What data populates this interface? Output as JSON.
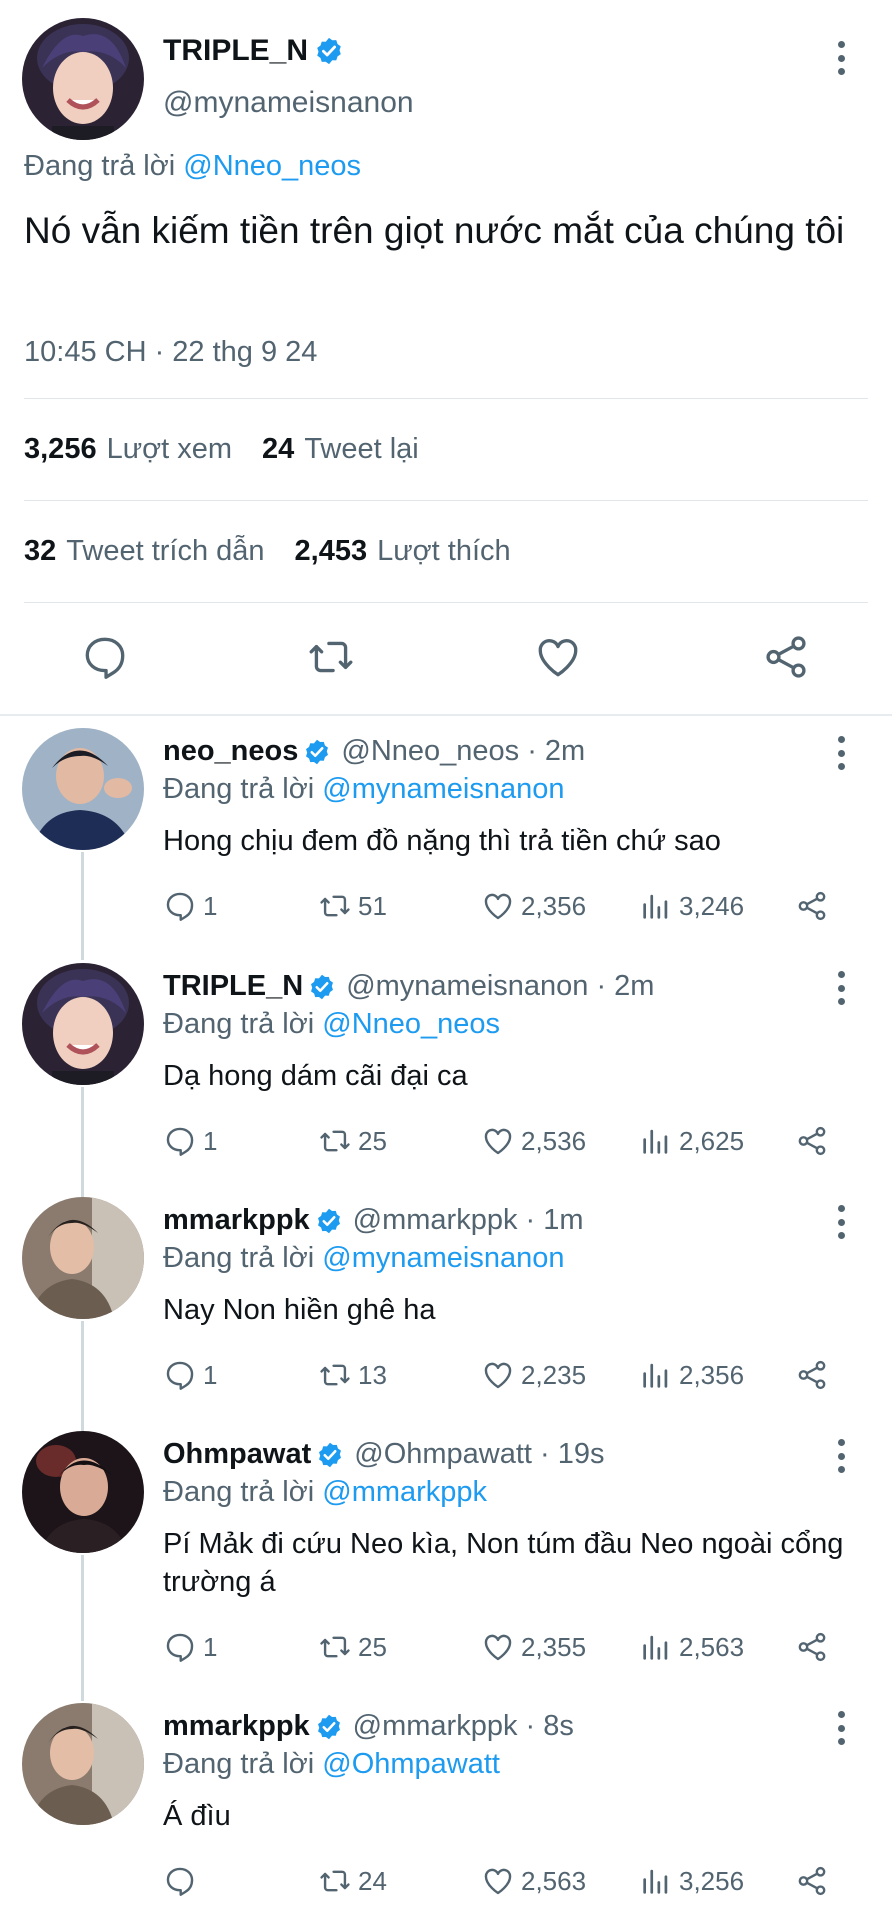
{
  "main_tweet": {
    "display_name": "TRIPLE_N",
    "handle": "@mynameisnanon",
    "replying_prefix": "Đang trả lời ",
    "replying_to": "@Nneo_neos",
    "text": "Nó vẫn kiếm tiền trên giọt nước mắt của chúng tôi",
    "timestamp": "10:45 CH · 22 thg 9 24",
    "views_count": "3,256",
    "views_label": "Lượt xem",
    "retweets_count": "24",
    "retweets_label": "Tweet lại",
    "quotes_count": "32",
    "quotes_label": "Tweet trích dẫn",
    "likes_count": "2,453",
    "likes_label": "Lượt thích"
  },
  "replies": [
    {
      "display_name": "neo_neos",
      "handle_time": "@Nneo_neos · 2m",
      "replying_prefix": "Đang trả lời ",
      "replying_to": "@mynameisnanon",
      "text": "Hong chịu đem đồ nặng thì trả tiền chứ sao",
      "replies": "1",
      "retweets": "51",
      "likes": "2,356",
      "views": "3,246"
    },
    {
      "display_name": "TRIPLE_N",
      "handle_time": "@mynameisnanon · 2m",
      "replying_prefix": "Đang trả lời ",
      "replying_to": "@Nneo_neos",
      "text": "Dạ hong dám cãi đại ca",
      "replies": "1",
      "retweets": "25",
      "likes": "2,536",
      "views": "2,625"
    },
    {
      "display_name": "mmarkppk",
      "handle_time": "@mmarkppk · 1m",
      "replying_prefix": "Đang trả lời ",
      "replying_to": "@mynameisnanon",
      "text": "Nay Non hiền ghê ha",
      "replies": "1",
      "retweets": "13",
      "likes": "2,235",
      "views": "2,356"
    },
    {
      "display_name": "Ohmpawat",
      "handle_time": "@Ohmpawatt · 19s",
      "replying_prefix": "Đang trả lời ",
      "replying_to": "@mmarkppk",
      "text": "Pí Mảk đi cứu Neo kìa, Non túm đầu Neo ngoài cổng trường á",
      "replies": "1",
      "retweets": "25",
      "likes": "2,355",
      "views": "2,563"
    },
    {
      "display_name": "mmarkppk",
      "handle_time": "@mmarkppk · 8s",
      "replying_prefix": "Đang trả lời ",
      "replying_to": "@Ohmpawatt",
      "text": "Á đìu",
      "replies": "",
      "retweets": "24",
      "likes": "2,563",
      "views": "3,256"
    }
  ],
  "colors": {
    "accent_blue": "#1d9bf0",
    "secondary_text": "#536471",
    "primary_text": "#0f1419",
    "divider": "#e1e6ea"
  },
  "icons": [
    "verified-badge-icon",
    "more-options-icon",
    "reply-icon",
    "retweet-icon",
    "like-icon",
    "views-icon",
    "share-icon"
  ]
}
